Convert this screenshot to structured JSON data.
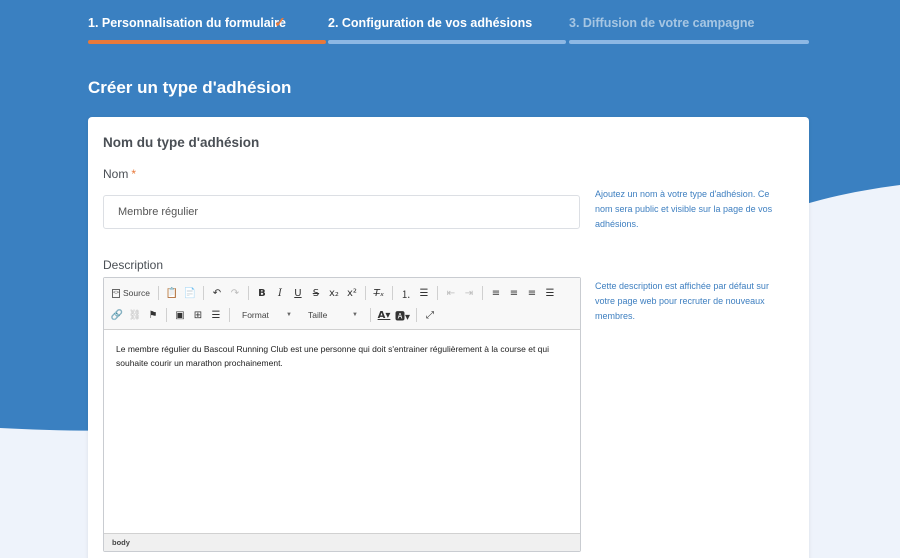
{
  "colors": {
    "primary_blue": "#3a80c1",
    "light_bg": "#eef3fb",
    "accent_orange": "#e8793a",
    "step_pending": "#8db8e4"
  },
  "stepper": {
    "steps": [
      {
        "label": "1. Personnalisation du formulaire",
        "state": "completed",
        "icon": "check-icon"
      },
      {
        "label": "2. Configuration de vos adhésions",
        "state": "current"
      },
      {
        "label": "3. Diffusion de votre campagne",
        "state": "pending"
      }
    ]
  },
  "page": {
    "title": "Créer un type d'adhésion"
  },
  "form": {
    "section_title": "Nom du type d'adhésion",
    "name": {
      "label": "Nom",
      "required_mark": "*",
      "value": "Membre régulier",
      "help": "Ajoutez un nom à votre type d'adhésion. Ce nom sera public et visible sur la page de vos adhésions."
    },
    "description": {
      "label": "Description",
      "help": "Cette description est affichée par défaut sur votre page web pour recruter de nouveaux membres.",
      "content": "Le membre régulier du Bascoul Running Club est une personne qui doit s'entrainer régulièrement à la course et qui souhaite courir un marathon prochainement.",
      "status_path": "body"
    }
  },
  "editor_toolbar": {
    "source_label": "Source",
    "format_label": "Format",
    "size_label": "Taille",
    "row1_icons": [
      "source-icon",
      "paste-text-icon",
      "paste-word-icon",
      "undo-icon",
      "redo-icon",
      "bold-icon",
      "italic-icon",
      "underline-icon",
      "strikethrough-icon",
      "subscript-icon",
      "superscript-icon",
      "remove-format-icon",
      "numbered-list-icon",
      "bulleted-list-icon",
      "outdent-icon",
      "indent-icon",
      "align-left-icon",
      "align-center-icon",
      "align-right-icon",
      "justify-icon"
    ],
    "row2_icons": [
      "link-icon",
      "unlink-icon",
      "anchor-icon",
      "image-icon",
      "table-icon",
      "horizontal-line-icon",
      "format-dropdown",
      "size-dropdown",
      "text-color-icon",
      "background-color-icon",
      "maximize-icon"
    ]
  }
}
